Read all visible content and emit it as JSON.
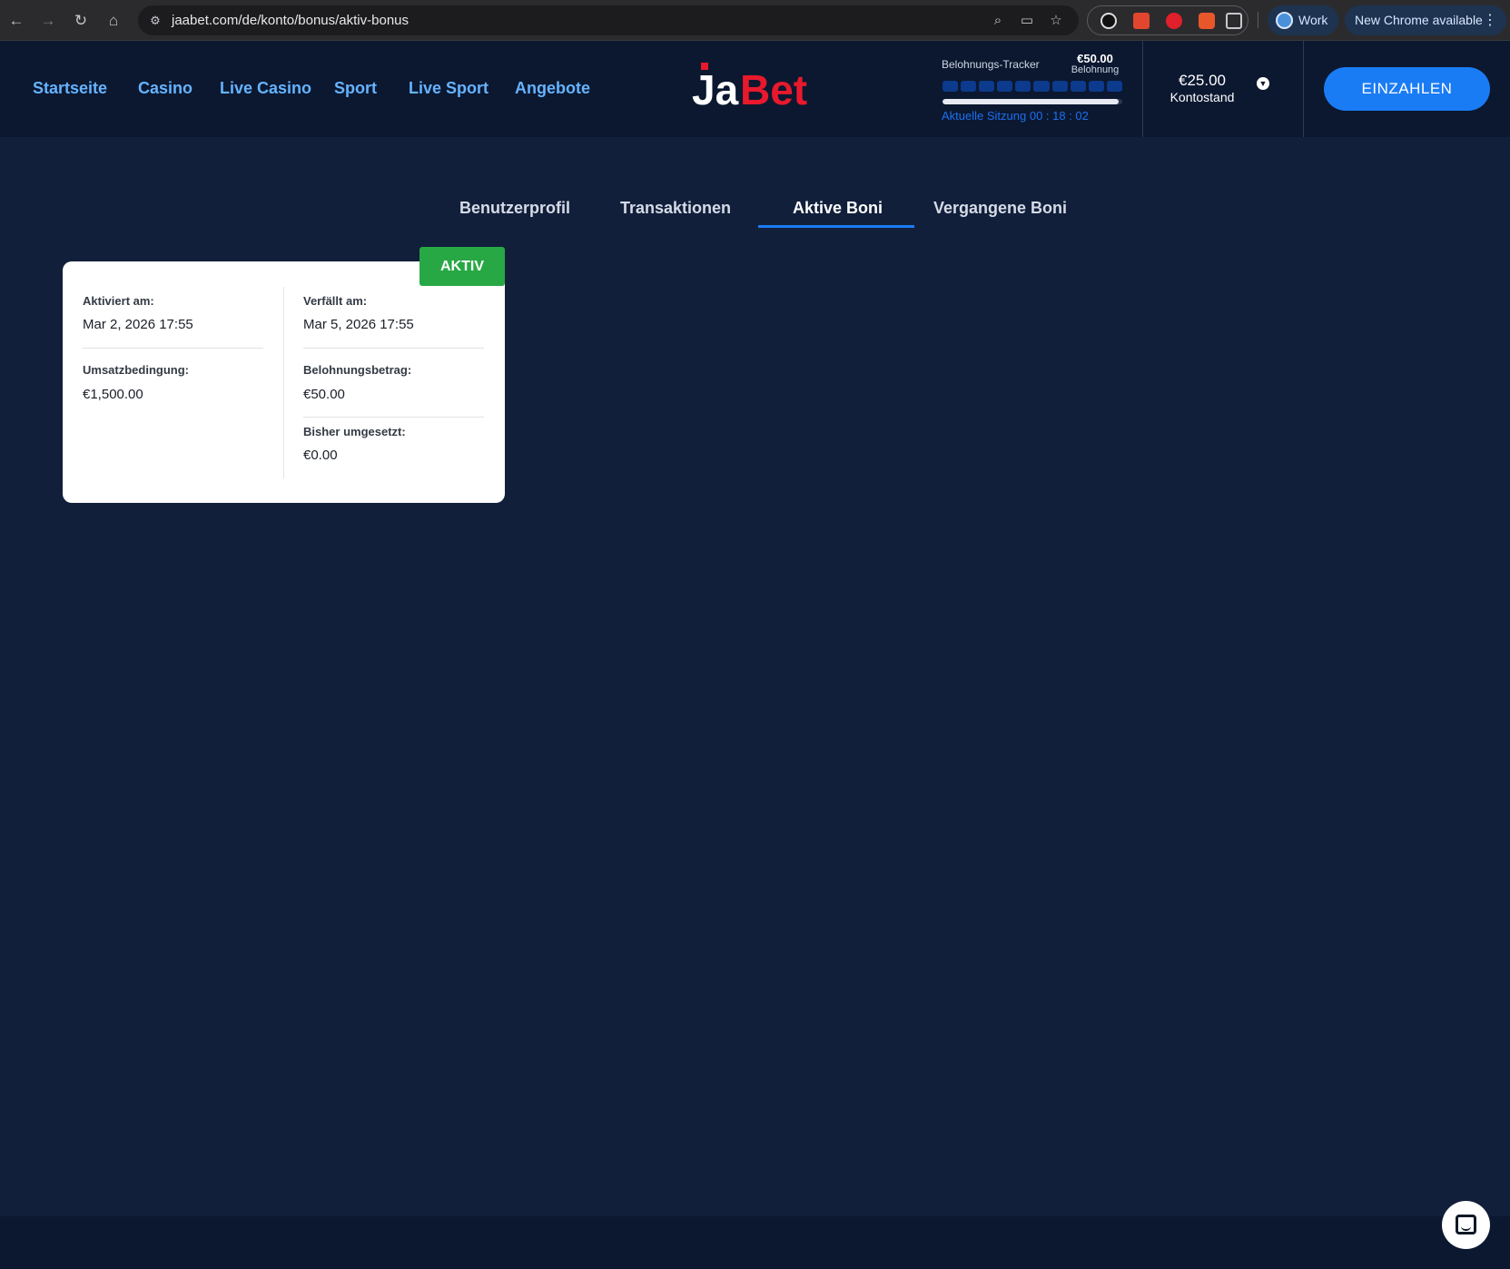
{
  "browser": {
    "url": "jaabet.com/de/konto/bonus/aktiv-bonus",
    "profile_label": "Work",
    "update_label": "New Chrome available"
  },
  "nav": {
    "items": [
      "Startseite",
      "Casino",
      "Live Casino",
      "Sport",
      "Live Sport",
      "Angebote"
    ]
  },
  "logo": {
    "text_ja": "Ja",
    "text_bet": "Bet",
    "brand_red": "#e8192c"
  },
  "tracker": {
    "title": "Belohnungs-Tracker",
    "amount": "€50.00",
    "reward_label": "Belohnung",
    "segments": 10,
    "progress": 0.98,
    "session": "Aktuelle Sitzung 00 : 18 : 02"
  },
  "balance": {
    "amount": "€25.00",
    "label": "Kontostand"
  },
  "deposit": {
    "label": "EINZAHLEN",
    "color": "#1a7cf5"
  },
  "tabs": [
    {
      "label": "Benutzerprofil",
      "active": false
    },
    {
      "label": "Transaktionen",
      "active": false
    },
    {
      "label": "Aktive Boni",
      "active": true
    },
    {
      "label": "Vergangene Boni",
      "active": false
    }
  ],
  "bonus": {
    "status": "AKTIV",
    "status_color": "#27a844",
    "activated_label": "Aktiviert am:",
    "activated_value": "Mar 2, 2026 17:55",
    "expires_label": "Verfällt am:",
    "expires_value": "Mar 5, 2026 17:55",
    "wagering_label": "Umsatzbedingung:",
    "wagering_value": "€1,500.00",
    "reward_label": "Belohnungsbetrag:",
    "reward_value": "€50.00",
    "wagered_label": "Bisher umgesetzt:",
    "wagered_value": "€0.00"
  },
  "icons": {
    "back": "arrow-left-icon",
    "forward": "arrow-right-icon",
    "reload": "reload-icon",
    "home": "home-icon",
    "site_settings": "tune-icon",
    "zoom": "zoom-icon",
    "install": "install-icon",
    "bookmark": "star-icon",
    "extensions": "puzzle-icon",
    "chat": "chat-icon"
  }
}
